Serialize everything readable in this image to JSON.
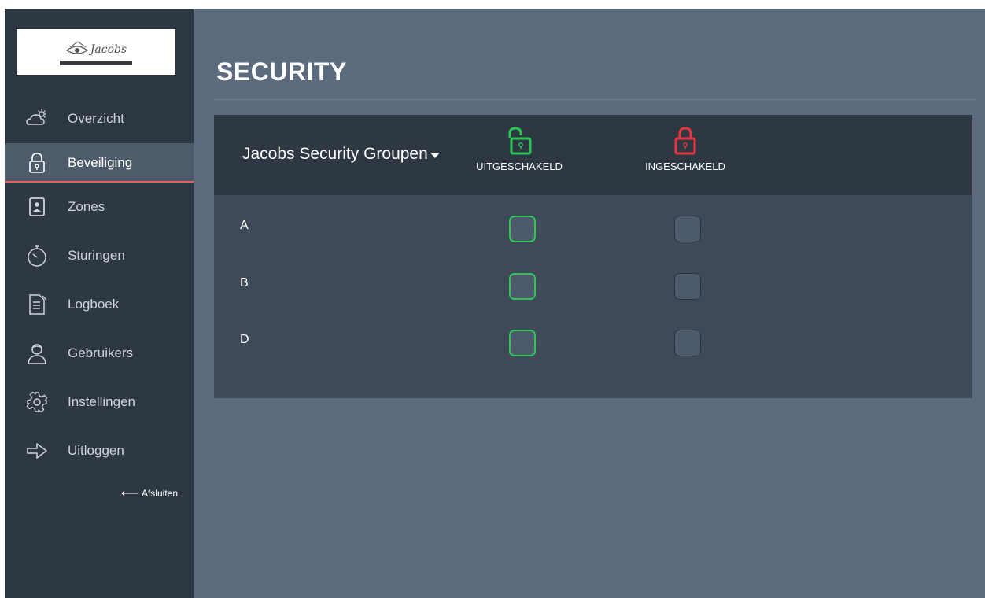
{
  "sidebar": {
    "logo_text": "Jacobs",
    "items": [
      {
        "label": "Overzicht",
        "icon": "weather-icon"
      },
      {
        "label": "Beveiliging",
        "icon": "lock-icon",
        "active": true
      },
      {
        "label": "Zones",
        "icon": "zone-icon"
      },
      {
        "label": "Sturingen",
        "icon": "timer-icon"
      },
      {
        "label": "Logboek",
        "icon": "logbook-icon"
      },
      {
        "label": "Gebruikers",
        "icon": "user-icon"
      },
      {
        "label": "Instellingen",
        "icon": "gear-icon"
      },
      {
        "label": "Uitloggen",
        "icon": "logout-icon"
      }
    ],
    "close_label": "Afsluiten"
  },
  "main": {
    "title": "SECURITY",
    "panel": {
      "group_select": "Jacobs Security Groupen",
      "columns": [
        {
          "label": "UITGESCHAKELD",
          "color": "#2dc653",
          "icon": "unlocked-icon"
        },
        {
          "label": "INGESCHAKELD",
          "color": "#e8353d",
          "icon": "locked-icon"
        }
      ],
      "rows": [
        {
          "label": "A",
          "disarmed_checked": true,
          "armed_checked": false
        },
        {
          "label": "B",
          "disarmed_checked": true,
          "armed_checked": false
        },
        {
          "label": "D",
          "disarmed_checked": true,
          "armed_checked": false
        }
      ]
    }
  },
  "colors": {
    "sidebar_bg": "#2e3843",
    "main_bg": "#5b6a7d",
    "active_underline": "#e2625b",
    "disarmed": "#2dc653",
    "armed": "#e8353d"
  }
}
